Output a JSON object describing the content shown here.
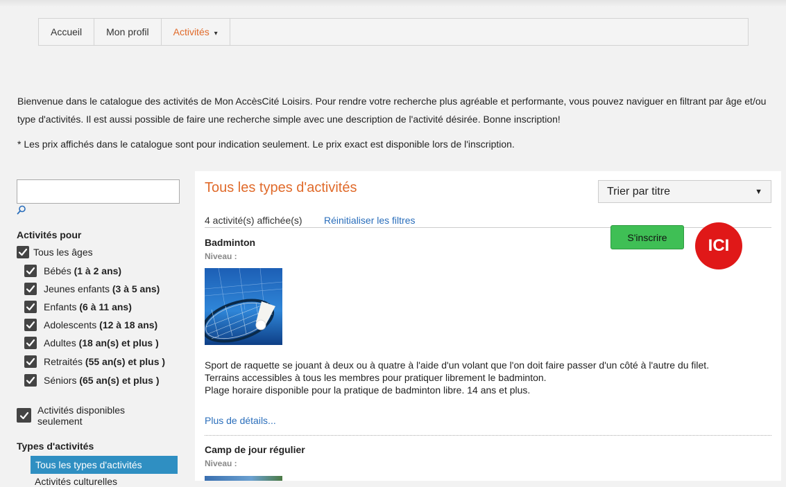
{
  "nav": {
    "items": [
      {
        "label": "Accueil"
      },
      {
        "label": "Mon profil"
      },
      {
        "label": "Activités"
      }
    ],
    "caret": "▾"
  },
  "intro": "Bienvenue dans le catalogue des activités de Mon AccèsCité Loisirs. Pour rendre votre recherche plus agréable et performante, vous pouvez naviguer en filtrant par âge et/ou type d'activités. Il est aussi possible de faire une recherche simple avec une description de l'activité désirée. Bonne inscription!",
  "note": "* Les prix affichés dans le catalogue sont pour indication seulement. Le prix exact est disponible lors de l'inscription.",
  "sidebar": {
    "search_value": "",
    "ages_heading": "Activités pour",
    "all_ages": "Tous les âges",
    "ages": [
      {
        "label": "Bébés",
        "range": "(1 à 2 ans)"
      },
      {
        "label": "Jeunes enfants",
        "range": "(3 à 5 ans)"
      },
      {
        "label": "Enfants",
        "range": "(6 à 11 ans)"
      },
      {
        "label": "Adolescents",
        "range": "(12 à 18 ans)"
      },
      {
        "label": "Adultes",
        "range": "(18 an(s) et plus )"
      },
      {
        "label": "Retraités",
        "range": "(55 an(s) et plus )"
      },
      {
        "label": "Séniors",
        "range": "(65 an(s) et plus )"
      }
    ],
    "available_line1": "Activités disponibles",
    "available_line2": "seulement",
    "types_heading": "Types d'activités",
    "types_selected": "Tous les types d'activités",
    "types_next": "Activités culturelles"
  },
  "main": {
    "title": "Tous les types d'activités",
    "sort_value": "Trier par titre",
    "count": "4 activité(s) affichée(s)",
    "reset": "Réinitialiser les filtres",
    "inscrire": "S'inscrire",
    "ici": "ICI",
    "activities": [
      {
        "title": "Badminton",
        "level": "Niveau :",
        "desc": [
          "Sport de raquette se jouant à deux ou à quatre à l'aide d'un volant que l'on doit faire passer d'un côté à l'autre du filet.",
          "Terrains accessibles à tous les membres pour pratiquer librement le badminton.",
          "Plage horaire disponible pour la pratique de badminton libre. 14 ans et plus."
        ],
        "details": "Plus de détails..."
      },
      {
        "title": "Camp de jour régulier",
        "level": "Niveau :"
      }
    ]
  },
  "colors": {
    "accent": "#e06a2a",
    "link": "#2a6ebb",
    "button": "#3fbf55",
    "ici": "#e01818",
    "selected": "#2f8fc2"
  }
}
